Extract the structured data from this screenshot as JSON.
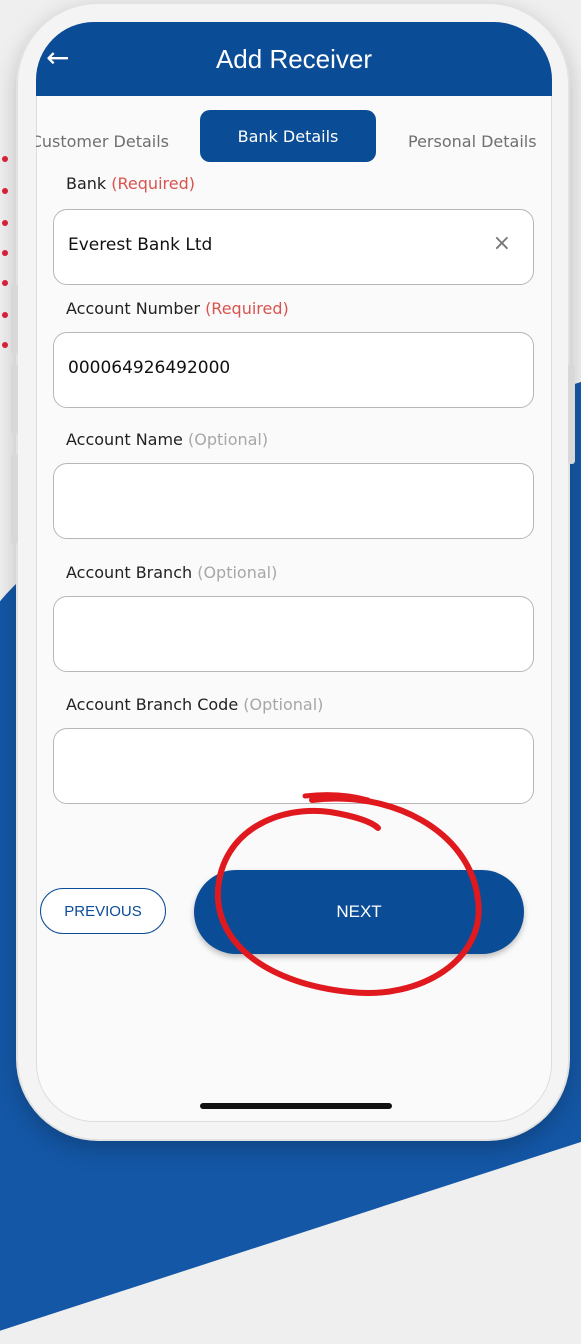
{
  "header": {
    "title": "Add Receiver",
    "back_icon": "←"
  },
  "tabs": [
    {
      "label": "Customer Details",
      "active": false
    },
    {
      "label": "Bank Details",
      "active": true
    },
    {
      "label": "Personal Details",
      "active": false
    }
  ],
  "fields": {
    "bank": {
      "label": "Bank",
      "tag": "(Required)",
      "value": "Everest Bank Ltd",
      "clear_icon": "×"
    },
    "account_number": {
      "label": "Account Number",
      "tag": "(Required)",
      "value": "000064926492000"
    },
    "account_name": {
      "label": "Account Name",
      "tag": "(Optional)",
      "value": ""
    },
    "account_branch": {
      "label": "Account Branch",
      "tag": "(Optional)",
      "value": ""
    },
    "account_branch_code": {
      "label": "Account Branch Code",
      "tag": "(Optional)",
      "value": ""
    }
  },
  "buttons": {
    "previous": "PREVIOUS",
    "next": "NEXT"
  },
  "colors": {
    "primary": "#0b4c97",
    "required": "#d9534f",
    "optional": "#a7a7a7",
    "annotation": "#e0191f",
    "background_shape": "#1457a6"
  }
}
